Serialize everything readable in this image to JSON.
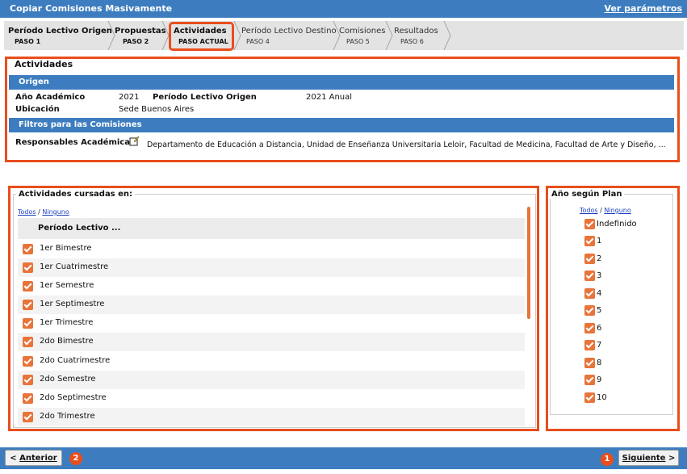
{
  "window": {
    "title": "Copiar Comisiones Masivamente",
    "ver_parametros": "Ver parámetros"
  },
  "wizard": {
    "steps": [
      {
        "name": "Período Lectivo Origen",
        "paso": "PASO 1"
      },
      {
        "name": "Propuestas",
        "paso": "PASO 2"
      },
      {
        "name": "Actividades",
        "paso": "PASO ACTUAL"
      },
      {
        "name": "Período Lectivo Destino",
        "paso": "PASO 4"
      },
      {
        "name": "Comisiones",
        "paso": "PASO 5"
      },
      {
        "name": "Resultados",
        "paso": "PASO 6"
      }
    ]
  },
  "actividades": {
    "title": "Actividades",
    "origen_header": "Origen",
    "anio_label": "Año Académico",
    "anio_value": "2021",
    "periodo_label": "Período Lectivo Origen",
    "periodo_value": "2021 Anual",
    "ubicacion_label": "Ubicación",
    "ubicacion_value": "Sede Buenos Aires",
    "filtros_header": "Filtros para las Comisiones",
    "responsables_label": "Responsables Académicas",
    "responsables_value": "Departamento de Educación a Distancia, Unidad de Enseñanza Universitaria Leloir, Facultad de Medicina, Facultad de Arte y Diseño, ..."
  },
  "cursadas": {
    "legend": "Actividades cursadas en:",
    "todos": "Todos",
    "ninguno": "Ninguno",
    "column_header": "Período Lectivo ...",
    "rows": [
      "1er Bimestre",
      "1er Cuatrimestre",
      "1er Semestre",
      "1er Septimestre",
      "1er Trimestre",
      "2do Bimestre",
      "2do Cuatrimestre",
      "2do Semestre",
      "2do Septimestre",
      "2do Trimestre"
    ]
  },
  "anio_plan": {
    "legend": "Año según Plan",
    "todos": "Todos",
    "ninguno": "Ninguno",
    "items": [
      "Indefinido",
      "1",
      "2",
      "3",
      "4",
      "5",
      "6",
      "7",
      "8",
      "9",
      "10"
    ]
  },
  "footer": {
    "anterior": "Anterior",
    "siguiente": "Siguiente",
    "marker_anterior": "2",
    "marker_siguiente": "1"
  },
  "colors": {
    "brand_blue": "#3d7dbf",
    "highlight": "#e94d1c",
    "checkbox": "#e8743a"
  }
}
